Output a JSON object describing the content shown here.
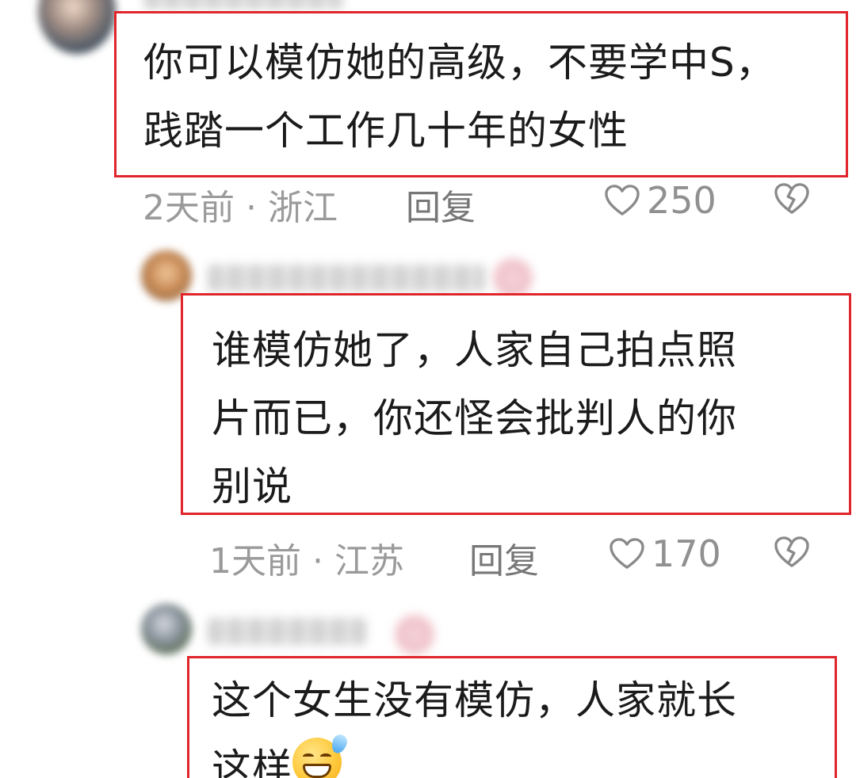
{
  "comments": [
    {
      "text": "你可以模仿她的高级，不要学中S，\n践踏一个工作几十年的女性",
      "time_location": "2天前 · 浙江",
      "reply_label": "回复",
      "like_count": "250",
      "avatar_icon": "blurred-avatar",
      "username_blurred": true
    },
    {
      "text": "谁模仿她了，人家自己拍点照\n片而已，你还怪会批判人的你\n别说",
      "time_location": "1天前 · 江苏",
      "reply_label": "回复",
      "like_count": "170",
      "avatar_icon": "blurred-avatar",
      "username_blurred": true
    },
    {
      "text": "这个女生没有模仿，人家就长\n这样",
      "emoji": "grinning-sweat-emoji",
      "avatar_icon": "blurred-avatar",
      "username_blurred": true
    }
  ],
  "icons": {
    "like": "heart-outline-icon",
    "dislike": "broken-heart-icon"
  },
  "colors": {
    "highlight_border": "#e0252b",
    "meta_text": "#9a9a9a",
    "comment_text": "#1b1b1b"
  }
}
